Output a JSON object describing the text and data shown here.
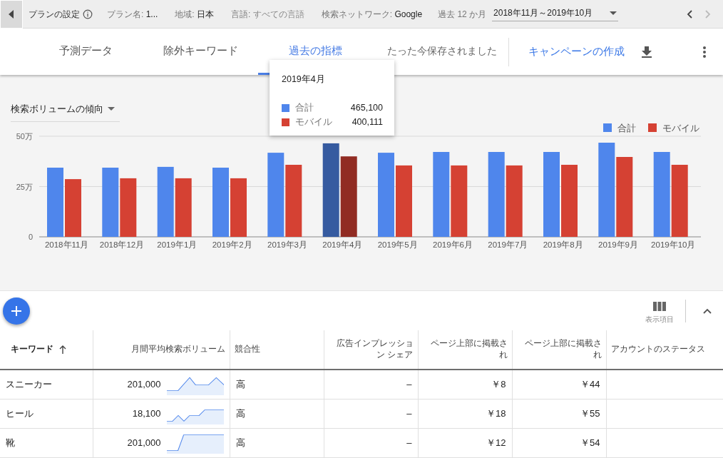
{
  "top_bar": {
    "title": "プランの設定",
    "filters": [
      {
        "label": "プラン名:",
        "value": "1...",
        "muted": false
      },
      {
        "label": "地域:",
        "value": "日本",
        "muted": false
      },
      {
        "label": "言語:",
        "value": "すべての言語",
        "muted": true
      },
      {
        "label": "検索ネットワーク:",
        "value": "Google",
        "muted": false
      }
    ],
    "period_label": "過去 12 か月",
    "date_range": "2018年11月～2019年10月"
  },
  "tabs": [
    {
      "label": "予測データ",
      "selected": false
    },
    {
      "label": "除外キーワード",
      "selected": false
    },
    {
      "label": "過去の指標",
      "selected": true
    }
  ],
  "save_status": "たった今保存されました",
  "create_campaign": "キャンペーンの作成",
  "chart": {
    "selector": "検索ボリュームの傾向",
    "highlighted": [
      false,
      false,
      false,
      false,
      false,
      true,
      false,
      false,
      false,
      false,
      false,
      false
    ],
    "chart_data": {
      "type": "bar",
      "categories": [
        "2018年11月",
        "2018年12月",
        "2019年1月",
        "2019年2月",
        "2019年3月",
        "2019年4月",
        "2019年5月",
        "2019年6月",
        "2019年7月",
        "2019年8月",
        "2019年9月",
        "2019年10月"
      ],
      "series": [
        {
          "name": "合計",
          "color": "#4f86ec",
          "values": [
            34.4,
            34.4,
            34.8,
            34.4,
            41.8,
            46.5,
            41.8,
            42.2,
            42.2,
            42.2,
            46.8,
            42.2
          ]
        },
        {
          "name": "モバイル",
          "color": "#d54133",
          "values": [
            28.7,
            29.1,
            29.1,
            29.1,
            35.8,
            40.0,
            35.5,
            35.5,
            35.5,
            35.8,
            39.7,
            35.8
          ]
        }
      ],
      "legend": "top right",
      "ylim": [
        0,
        50
      ],
      "yticks": [
        0,
        {
          "value": 25,
          "label": "25万"
        },
        {
          "value": 50,
          "label": "50万"
        }
      ]
    }
  },
  "tooltip": {
    "title": "2019年4月",
    "rows": [
      {
        "label": "合計",
        "value": "465,100",
        "color": "#4f86ec"
      },
      {
        "label": "モバイル",
        "value": "400,111",
        "color": "#d54133"
      }
    ]
  },
  "toolbar": {
    "columns_label": "表示項目"
  },
  "table": {
    "columns": [
      {
        "label": "キーワード",
        "sorted": true
      },
      {
        "label": "月間平均検索ボリューム",
        "sorted": false
      },
      {
        "label": "競合性",
        "sorted": false
      },
      {
        "label": "広告インプレッション シェア",
        "sorted": false
      },
      {
        "label": "ページ上部に掲載され",
        "sorted": false
      },
      {
        "label": "ページ上部に掲載され",
        "sorted": false
      },
      {
        "label": "アカウントのステータス",
        "sorted": false
      }
    ],
    "rows": [
      {
        "keyword": "スニーカー",
        "volume": "201,000",
        "competition": "高",
        "impression_share": "–",
        "bid_low": "￥8",
        "bid_high": "￥44"
      },
      {
        "keyword": "ヒール",
        "volume": "18,100",
        "competition": "高",
        "impression_share": "–",
        "bid_low": "￥18",
        "bid_high": "￥55"
      },
      {
        "keyword": "靴",
        "volume": "201,000",
        "competition": "高",
        "impression_share": "–",
        "bid_low": "￥12",
        "bid_high": "￥54"
      }
    ]
  }
}
